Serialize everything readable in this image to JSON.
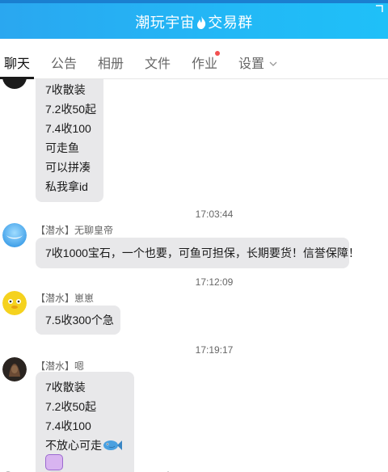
{
  "window": {
    "title_part1": "潮玩宇宙",
    "title_icon": "flame-icon",
    "title_part2": "交易群"
  },
  "tabs": [
    {
      "label": "聊天",
      "active": true
    },
    {
      "label": "公告"
    },
    {
      "label": "相册"
    },
    {
      "label": "文件"
    },
    {
      "label": "作业",
      "badge": "red-dot"
    },
    {
      "label": "设置",
      "icon": "chevron-down-icon"
    }
  ],
  "messages": {
    "first": {
      "lines": [
        "7收散装",
        "7.2收50起",
        "7.4收100",
        "可走鱼",
        "可以拼凑",
        "私我拿id"
      ]
    },
    "m1": {
      "time": "17:03:44",
      "sender": "【潜水】无聊皇帝",
      "text": "7收1000宝石，一个也要，可鱼可担保，长期要货！信誉保障！"
    },
    "m2": {
      "time": "17:12:09",
      "sender": "【潜水】崽崽",
      "text": "7.5收300个急"
    },
    "m3": {
      "time": "17:19:17",
      "sender": "【潜水】嗯",
      "lines": [
        "7收散装",
        "7.2收50起",
        "7.4收100",
        "不放心可走"
      ],
      "emoji": "fish-emoji"
    }
  },
  "colors": {
    "title_bar": "#22b8f6",
    "bubble": "#e8e8ea",
    "badge": "#f35050"
  }
}
